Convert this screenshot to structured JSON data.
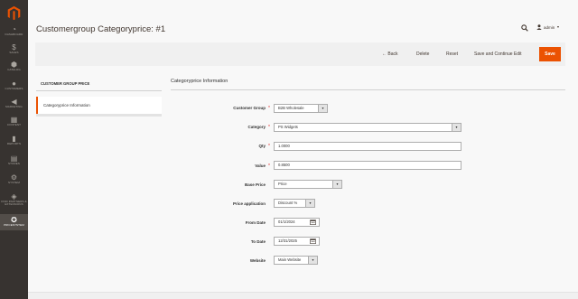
{
  "colors": {
    "sidebar": "#373330",
    "accent": "#eb5202",
    "required": "#e22626"
  },
  "sidebar": {
    "logo_icon": "magento-logo-icon",
    "items": [
      {
        "label": "DASHBOARD",
        "icon": "dashboard-icon"
      },
      {
        "label": "SALES",
        "icon": "dollar-icon"
      },
      {
        "label": "CATALOG",
        "icon": "cube-icon"
      },
      {
        "label": "CUSTOMERS",
        "icon": "person-icon"
      },
      {
        "label": "MARKETING",
        "icon": "megaphone-icon"
      },
      {
        "label": "CONTENT",
        "icon": "layout-icon"
      },
      {
        "label": "REPORTS",
        "icon": "bar-chart-icon"
      },
      {
        "label": "STORES",
        "icon": "store-icon"
      },
      {
        "label": "SYSTEM",
        "icon": "gear-icon"
      },
      {
        "label": "FIND PARTNERS & EXTENSIONS",
        "icon": "partners-icon"
      },
      {
        "label": "PRICESYSTEM",
        "icon": "pricesystem-icon"
      }
    ]
  },
  "header": {
    "title": "Customergroup Categoryprice: #1",
    "user": "admin"
  },
  "actions": {
    "back": "Back",
    "delete": "Delete",
    "reset": "Reset",
    "save_continue": "Save and Continue Edit",
    "save": "Save"
  },
  "tabs": {
    "heading": "CUSTOMER GROUP PRICE",
    "active": "Categoryprice Information"
  },
  "form": {
    "section_title": "Categoryprice Information",
    "customer_group": {
      "label": "Customer Group",
      "value": "B2B Wholesale",
      "required": true
    },
    "category": {
      "label": "Category",
      "value": "PS Widgets",
      "required": true
    },
    "qty": {
      "label": "Qty",
      "value": "1.0000",
      "required": true
    },
    "value": {
      "label": "Value",
      "value": "0.8500",
      "required": true
    },
    "base_price": {
      "label": "Base Price",
      "value": "Price",
      "required": false
    },
    "price_application": {
      "label": "Price application",
      "value": "Discount %",
      "required": false
    },
    "from_date": {
      "label": "From Date",
      "value": "01/1/2024",
      "required": false
    },
    "to_date": {
      "label": "To Date",
      "value": "12/31/2025",
      "required": false
    },
    "website": {
      "label": "Website",
      "value": "Main Website",
      "required": false
    }
  }
}
